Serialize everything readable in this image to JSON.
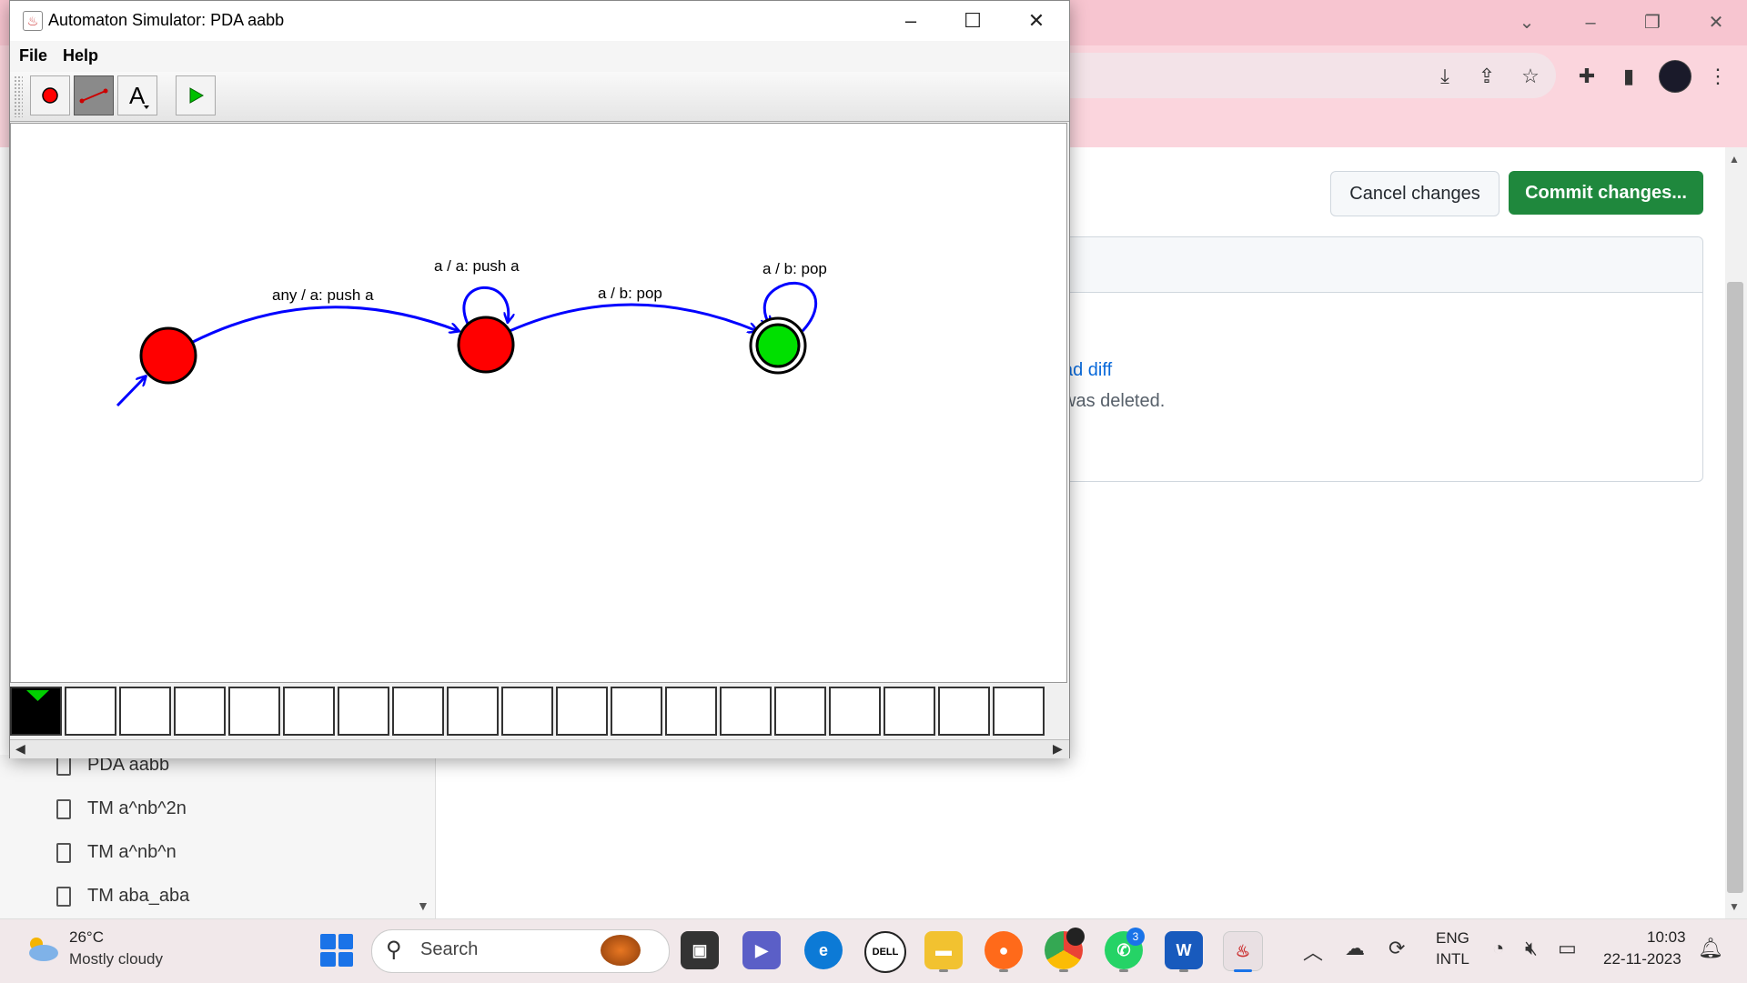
{
  "browser": {
    "cancel_label": "Cancel changes",
    "commit_label": "Commit changes...",
    "load_diff_text": "ad diff",
    "deleted_text": "was deleted.",
    "accent_green": "#1f883d",
    "link_blue": "#0969da",
    "files": [
      "PDA aabb",
      "TM a^nb^2n",
      "TM a^nb^n",
      "TM aba_aba"
    ]
  },
  "simulator": {
    "title": "Automaton Simulator: PDA aabb",
    "menu": [
      "File",
      "Help"
    ],
    "tools": [
      "state-tool",
      "transition-tool",
      "text-tool",
      "run-tool"
    ],
    "active_tool": "transition-tool",
    "transitions": [
      "any / a: push a",
      "a / a: push a",
      "a / b: pop",
      "a / b: pop"
    ],
    "state_colors": {
      "normal": "#ff0000",
      "accepting": "#00e000",
      "edge": "#0000ff"
    },
    "tape_cells": 19,
    "head_position": 0
  },
  "taskbar": {
    "weather_temp": "26°C",
    "weather_desc": "Mostly cloudy",
    "search_label": "Search",
    "lang_line1": "ENG",
    "lang_line2": "INTL",
    "time": "10:03",
    "date": "22-11-2023",
    "chrome_badge": "",
    "whatsapp_badge": "3"
  }
}
